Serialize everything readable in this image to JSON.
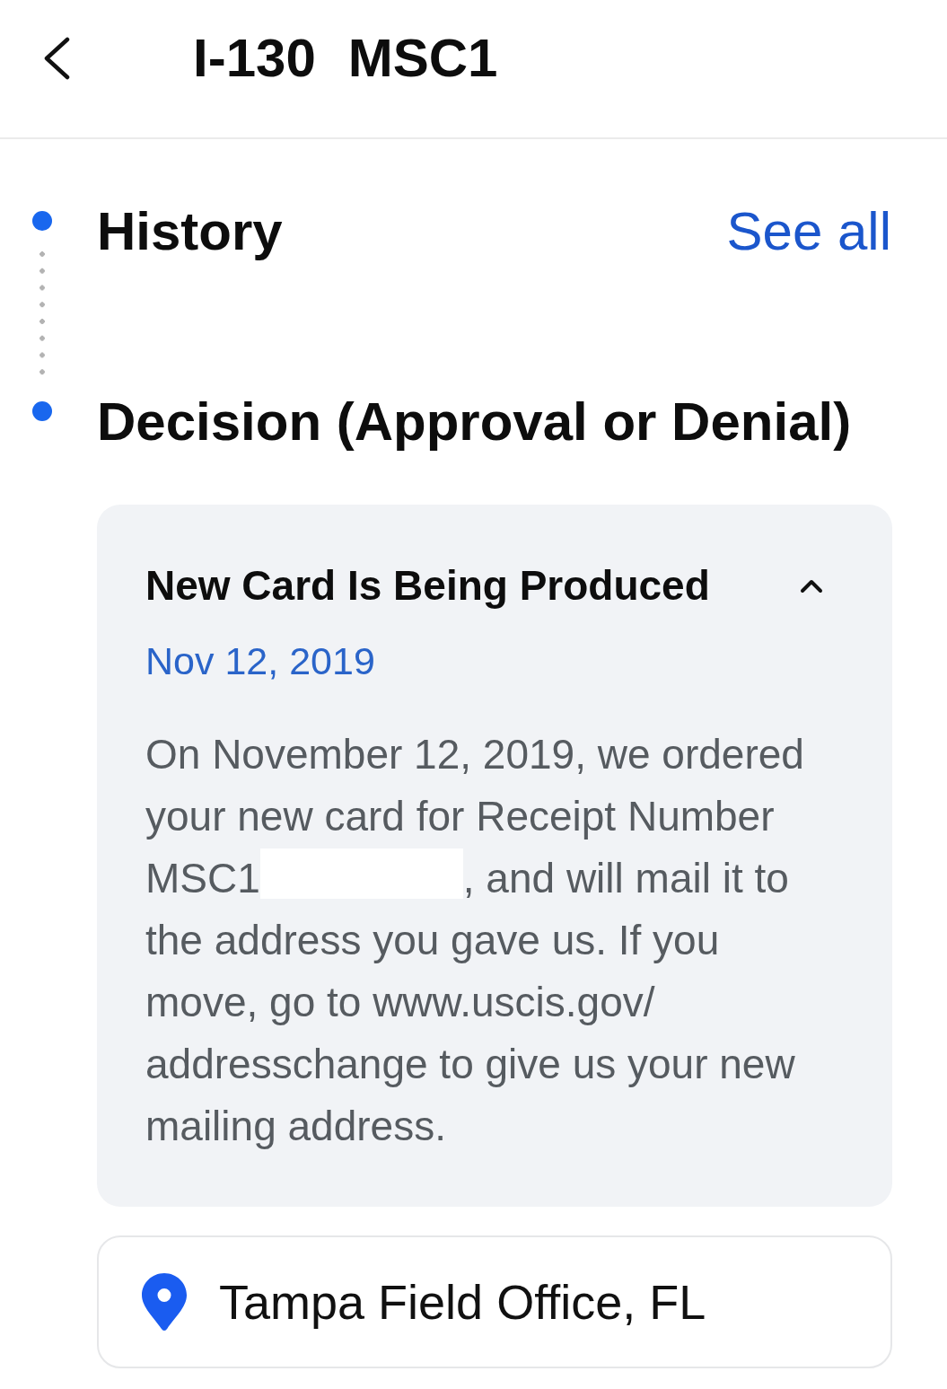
{
  "header": {
    "form": "I-130",
    "receipt": "MSC1"
  },
  "timeline": [
    {
      "label": "History",
      "link": "See all"
    },
    {
      "label": "Decision (Approval or Denial)"
    }
  ],
  "status_card": {
    "title": "New Card Is Being Produced",
    "expanded": true,
    "date": "Nov 12, 2019",
    "message_start": "On November 12, 2019, we ordered your new card for Receipt Number",
    "receipt_ref": "MSC1",
    "message_middle": ", and will mail it to",
    "message_end": "the address you gave us. If you move, go to www.uscis.gov/addresschange to give us your new mailing address."
  },
  "location": {
    "name": "Tampa Field Office, FL"
  }
}
